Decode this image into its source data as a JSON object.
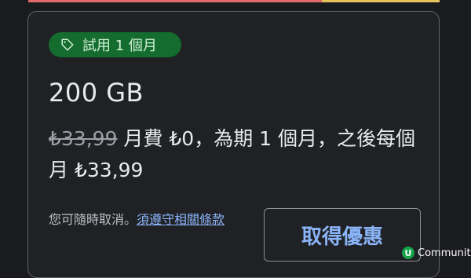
{
  "trial_badge": {
    "label": "試用 1 個月",
    "icon": "tag-icon"
  },
  "plan": {
    "title": "200 GB",
    "old_price": "₺33,99",
    "offer_text": " 月費 ₺0，為期 1 個月，之後每個月 ₺33,99"
  },
  "cancel_note": {
    "text": "您可隨時取消。",
    "terms_link": "須遵守相關條款"
  },
  "cta": {
    "label": "取得優惠"
  },
  "watermark": {
    "logo": "U",
    "text": "Community"
  },
  "colors": {
    "accent": "#8ab4f8",
    "chip_bg": "#146c2e",
    "background": "#1a1b1e"
  }
}
